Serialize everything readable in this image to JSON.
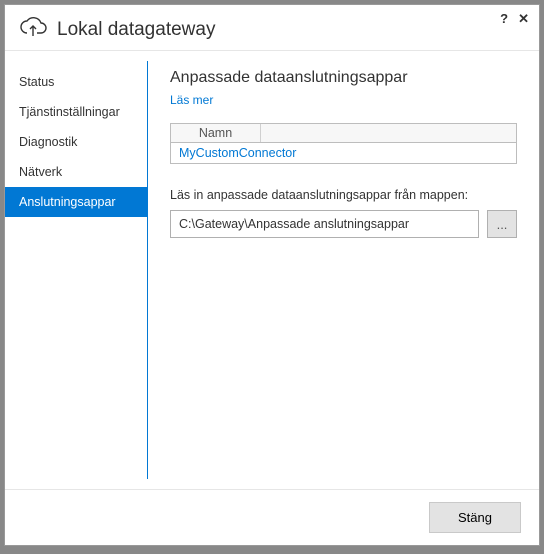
{
  "window": {
    "title": "Lokal datagateway"
  },
  "sidebar": {
    "items": [
      {
        "label": "Status"
      },
      {
        "label": "Tjänstinställningar"
      },
      {
        "label": "Diagnostik"
      },
      {
        "label": "Nätverk"
      },
      {
        "label": "Anslutningsappar"
      }
    ],
    "selectedIndex": 4
  },
  "main": {
    "heading": "Anpassade dataanslutningsappar",
    "learnMore": "Läs mer",
    "table": {
      "header": "Namn",
      "rows": [
        "MyCustomConnector"
      ]
    },
    "folder": {
      "label": "Läs in anpassade dataanslutningsappar från mappen:",
      "path": "C:\\Gateway\\Anpassade anslutningsappar",
      "browse": "..."
    }
  },
  "footer": {
    "close": "Stäng"
  }
}
